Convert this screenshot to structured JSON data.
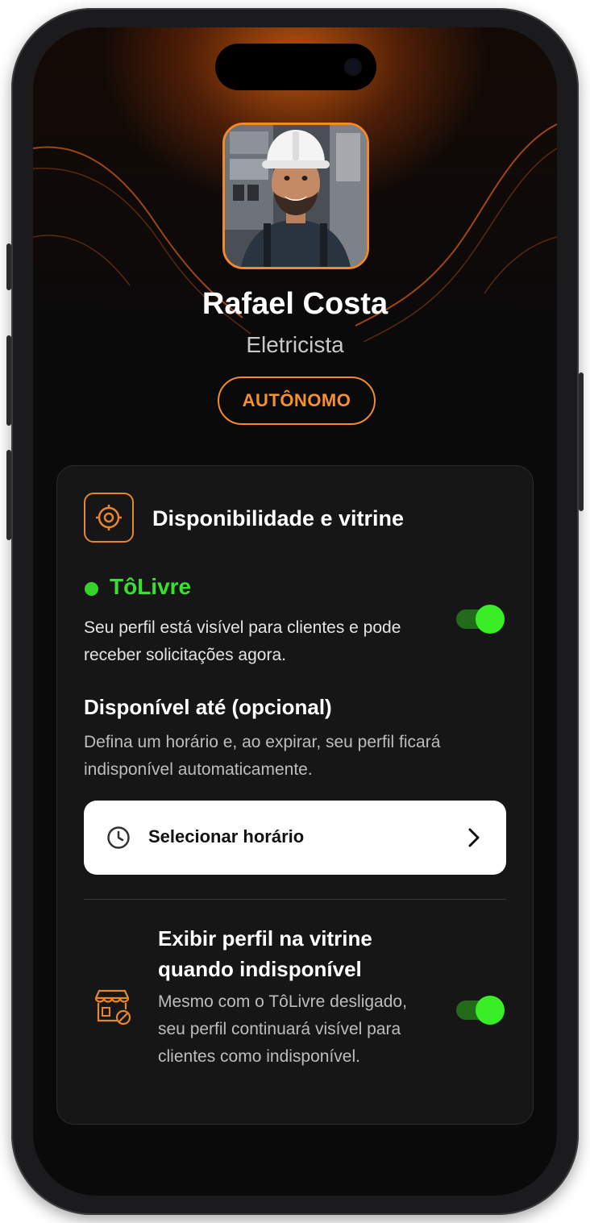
{
  "profile": {
    "name": "Rafael Costa",
    "role": "Eletricista",
    "badge": "AUTÔNOMO"
  },
  "card": {
    "title": "Disponibilidade e vitrine",
    "status": {
      "label": "TôLivre",
      "description": "Seu perfil está visível para clientes e pode receber solicitações agora.",
      "toggle_on": true
    },
    "available_until": {
      "title": "Disponível até (opcional)",
      "description": "Defina um horário e, ao expirar, seu perfil ficará indisponível automaticamente.",
      "button_label": "Selecionar horário"
    },
    "showcase": {
      "title": "Exibir perfil na vitrine quando indisponível",
      "description": "Mesmo com o TôLivre desligado, seu perfil continuará visível para clientes como indisponível.",
      "toggle_on": true
    }
  },
  "colors": {
    "accent": "#f08a2c",
    "status_green": "#39e02d",
    "background": "#0a0a0b"
  },
  "icons": {
    "header": "target-icon",
    "time": "clock-icon",
    "chevron": "chevron-right-icon",
    "showcase": "storefront-icon"
  }
}
